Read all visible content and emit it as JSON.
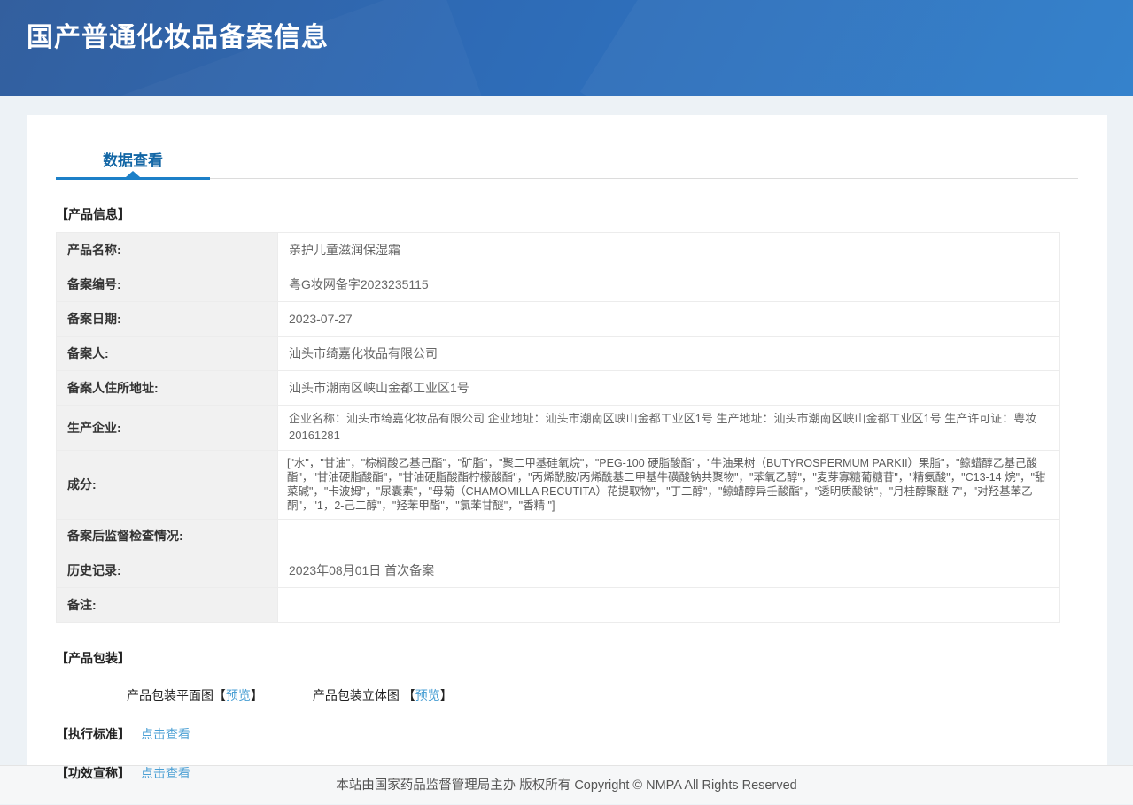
{
  "header": {
    "title": "国产普通化妆品备案信息"
  },
  "tab": {
    "label": "数据查看"
  },
  "sections": {
    "product_info": "【产品信息】",
    "packaging": "【产品包装】"
  },
  "table": {
    "rows": [
      {
        "label": "产品名称:",
        "value": "亲护儿童滋润保湿霜"
      },
      {
        "label": "备案编号:",
        "value": "粤G妆网备字2023235115"
      },
      {
        "label": "备案日期:",
        "value": "2023-07-27"
      },
      {
        "label": "备案人:",
        "value": "汕头市绮嘉化妆品有限公司"
      },
      {
        "label": "备案人住所地址:",
        "value": "汕头市潮南区峡山金都工业区1号"
      },
      {
        "label": "生产企业:",
        "value": "企业名称：汕头市绮嘉化妆品有限公司 企业地址：汕头市潮南区峡山金都工业区1号 生产地址：汕头市潮南区峡山金都工业区1号 生产许可证：粤妆20161281"
      },
      {
        "label": "成分:",
        "value": "[\"水\"，\"甘油\"，\"棕榈酸乙基己酯\"，\"矿脂\"，\"聚二甲基硅氧烷\"，\"PEG-100 硬脂酸酯\"，\"牛油果树（BUTYROSPERMUM PARKII）果脂\"，\"鲸蜡醇乙基己酸酯\"，\"甘油硬脂酸酯\"，\"甘油硬脂酸酯柠檬酸酯\"，\"丙烯酰胺/丙烯酰基二甲基牛磺酸钠共聚物\"，\"苯氧乙醇\"，\"麦芽寡糖葡糖苷\"，\"精氨酸\"，\"C13-14 烷\"，\"甜菜碱\"，\"卡波姆\"，\"尿囊素\"，\"母菊（CHAMOMILLA RECUTITA）花提取物\"，\"丁二醇\"，\"鲸蜡醇异壬酸酯\"，\"透明质酸钠\"，\"月桂醇聚醚-7\"，\"对羟基苯乙酮\"，\"1，2-己二醇\"，\"羟苯甲酯\"，\"氯苯甘醚\"，\"香精 \"]"
      },
      {
        "label": "备案后监督检查情况:",
        "value": ""
      },
      {
        "label": "历史记录:",
        "value": "2023年08月01日 首次备案"
      },
      {
        "label": "备注:",
        "value": ""
      }
    ]
  },
  "packaging": {
    "flat": {
      "label": "产品包装平面图",
      "bracket_open": "【",
      "link": "预览",
      "bracket_close": "】"
    },
    "solid": {
      "label": "产品包装立体图 ",
      "bracket_open": "【",
      "link": "预览",
      "bracket_close": "】"
    }
  },
  "standards": {
    "label": "【执行标准】",
    "link": "点击查看"
  },
  "efficacy": {
    "label": "【功效宣称】",
    "link": "点击查看"
  },
  "footer": {
    "copyright": "本站由国家药品监督管理局主办 版权所有 Copyright © NMPA All Rights Reserved"
  },
  "colors": {
    "header_gradient_start": "#335f9e",
    "header_gradient_end": "#2d7dca",
    "tab_text_blue": "#1266a5",
    "tab_bar_blue": "#1c80c8",
    "link_blue": "#4a9fd4",
    "table_border_blue": "#a9c6dc",
    "label_cell_bg": "#f1f1f1",
    "page_bg": "#edf2f6"
  }
}
